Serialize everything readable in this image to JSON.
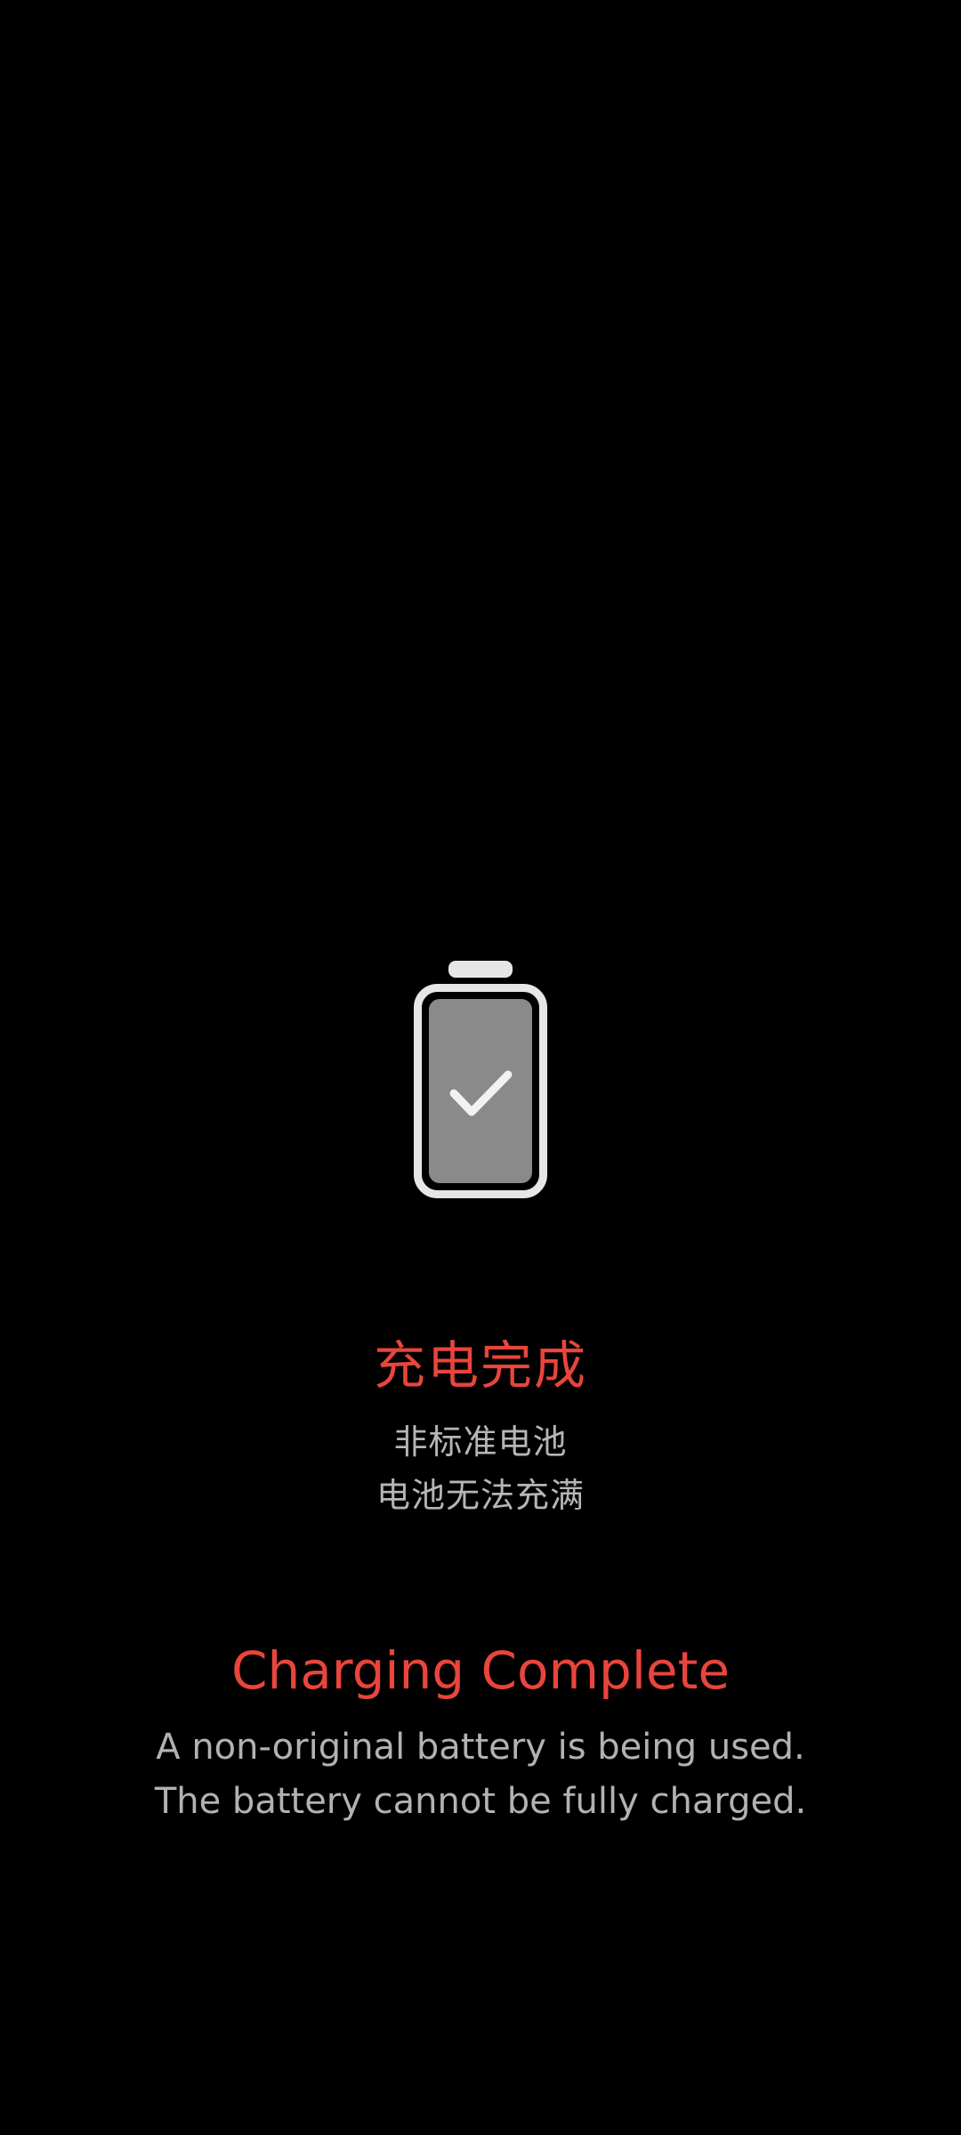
{
  "icons": {
    "battery": "battery-full-check-icon"
  },
  "colors": {
    "background": "#000000",
    "accent": "#e8453c",
    "message": "#b6b6b6",
    "battery_outline": "#e6e6e6",
    "battery_fill": "#8a8a8a"
  },
  "status": {
    "cn_title": "充电完成",
    "cn_message_line1": "非标准电池",
    "cn_message_line2": "电池无法充满",
    "en_title": "Charging Complete",
    "en_message_line1": "A non-original battery is being used.",
    "en_message_line2": "The battery cannot be fully charged."
  }
}
